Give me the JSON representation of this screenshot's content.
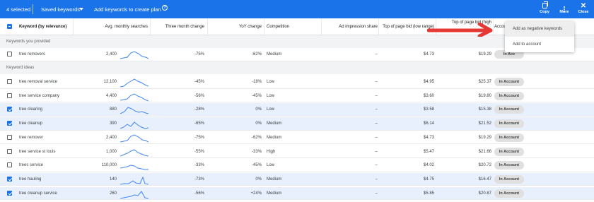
{
  "toolbar": {
    "selected_count": "4 selected",
    "saved_keywords": "Saved keywords",
    "add_to_plan": "Add keywords to create plan",
    "help_glyph": "?",
    "copy": "Copy",
    "more": "More",
    "close": "Close",
    "close_glyph": "✕"
  },
  "columns": {
    "keyword": "Keyword (by relevance)",
    "searches": "Avg. monthly searches",
    "three_month": "Three month change",
    "yoy": "YoY change",
    "competition": "Competition",
    "ad_share": "Ad impression share",
    "bid_low": "Top of page bid (low range)",
    "bid_high": "Top of page bid (high",
    "account": "Accou"
  },
  "sections": {
    "provided": "Keywords you provided",
    "ideas": "Keyword ideas"
  },
  "provided_rows": [
    {
      "keyword": "tree removers",
      "searches": "2,400",
      "three_month": "-75%",
      "yoy": "-62%",
      "competition": "Medium",
      "ad_share": "–",
      "bid_low": "$4.73",
      "bid_high": "$19.29",
      "status": "In Acc",
      "selected": false
    }
  ],
  "idea_rows": [
    {
      "keyword": "tree removal service",
      "searches": "12,100",
      "three_month": "-45%",
      "yoy": "-18%",
      "competition": "Low",
      "ad_share": "–",
      "bid_low": "$4.95",
      "bid_high": "$25.37",
      "status": "In Account",
      "selected": false
    },
    {
      "keyword": "tree service company",
      "searches": "4,400",
      "three_month": "-56%",
      "yoy": "-45%",
      "competition": "Low",
      "ad_share": "–",
      "bid_low": "$3.60",
      "bid_high": "$19.80",
      "status": "In Account",
      "selected": false
    },
    {
      "keyword": "tree clearing",
      "searches": "880",
      "three_month": "-28%",
      "yoy": "0%",
      "competition": "Low",
      "ad_share": "–",
      "bid_low": "$3.58",
      "bid_high": "$15.38",
      "status": "In Account",
      "selected": true
    },
    {
      "keyword": "tree cleanup",
      "searches": "390",
      "three_month": "-65%",
      "yoy": "0%",
      "competition": "Medium",
      "ad_share": "–",
      "bid_low": "$6.14",
      "bid_high": "$21.52",
      "status": "In Account",
      "selected": true
    },
    {
      "keyword": "tree remover",
      "searches": "2,400",
      "three_month": "-75%",
      "yoy": "-62%",
      "competition": "Medium",
      "ad_share": "–",
      "bid_low": "$4.73",
      "bid_high": "$19.29",
      "status": "In Account",
      "selected": false
    },
    {
      "keyword": "tree service st louis",
      "searches": "1,000",
      "three_month": "-55%",
      "yoy": "-33%",
      "competition": "High",
      "ad_share": "–",
      "bid_low": "$5.47",
      "bid_high": "$21.66",
      "status": "In Account",
      "selected": false
    },
    {
      "keyword": "trees service",
      "searches": "110,000",
      "three_month": "-33%",
      "yoy": "-45%",
      "competition": "Low",
      "ad_share": "–",
      "bid_low": "$4.02",
      "bid_high": "$20.72",
      "status": "In Account",
      "selected": false
    },
    {
      "keyword": "tree hauling",
      "searches": "140",
      "three_month": "-73%",
      "yoy": "0%",
      "competition": "Medium",
      "ad_share": "–",
      "bid_low": "$4.75",
      "bid_high": "$16.47",
      "status": "In Account",
      "selected": true
    },
    {
      "keyword": "tree cleanup service",
      "searches": "260",
      "three_month": "-56%",
      "yoy": "+24%",
      "competition": "Medium",
      "ad_share": "–",
      "bid_low": "$5.85",
      "bid_high": "$20.87",
      "status": "In Account",
      "selected": true
    }
  ],
  "menu": {
    "add_negative": "Add as negative keywords",
    "add_to_account": "Add to account"
  },
  "colors": {
    "brand_blue": "#1a73e8",
    "selected_row": "#e8f0fe",
    "arrow_red": "#e53935"
  }
}
